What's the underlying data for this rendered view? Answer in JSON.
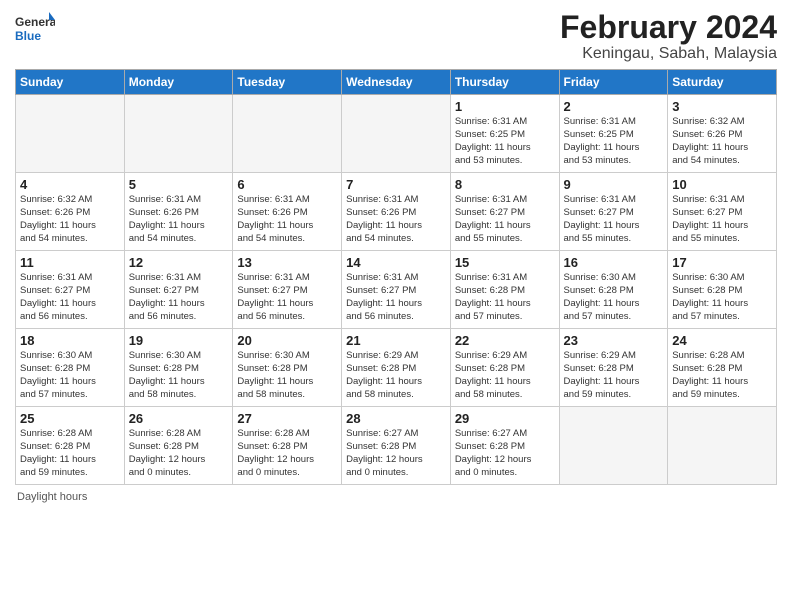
{
  "header": {
    "logo_general": "General",
    "logo_blue": "Blue",
    "month_title": "February 2024",
    "location": "Keningau, Sabah, Malaysia"
  },
  "days_of_week": [
    "Sunday",
    "Monday",
    "Tuesday",
    "Wednesday",
    "Thursday",
    "Friday",
    "Saturday"
  ],
  "weeks": [
    [
      {
        "day": "",
        "info": ""
      },
      {
        "day": "",
        "info": ""
      },
      {
        "day": "",
        "info": ""
      },
      {
        "day": "",
        "info": ""
      },
      {
        "day": "1",
        "info": "Sunrise: 6:31 AM\nSunset: 6:25 PM\nDaylight: 11 hours\nand 53 minutes."
      },
      {
        "day": "2",
        "info": "Sunrise: 6:31 AM\nSunset: 6:25 PM\nDaylight: 11 hours\nand 53 minutes."
      },
      {
        "day": "3",
        "info": "Sunrise: 6:32 AM\nSunset: 6:26 PM\nDaylight: 11 hours\nand 54 minutes."
      }
    ],
    [
      {
        "day": "4",
        "info": "Sunrise: 6:32 AM\nSunset: 6:26 PM\nDaylight: 11 hours\nand 54 minutes."
      },
      {
        "day": "5",
        "info": "Sunrise: 6:31 AM\nSunset: 6:26 PM\nDaylight: 11 hours\nand 54 minutes."
      },
      {
        "day": "6",
        "info": "Sunrise: 6:31 AM\nSunset: 6:26 PM\nDaylight: 11 hours\nand 54 minutes."
      },
      {
        "day": "7",
        "info": "Sunrise: 6:31 AM\nSunset: 6:26 PM\nDaylight: 11 hours\nand 54 minutes."
      },
      {
        "day": "8",
        "info": "Sunrise: 6:31 AM\nSunset: 6:27 PM\nDaylight: 11 hours\nand 55 minutes."
      },
      {
        "day": "9",
        "info": "Sunrise: 6:31 AM\nSunset: 6:27 PM\nDaylight: 11 hours\nand 55 minutes."
      },
      {
        "day": "10",
        "info": "Sunrise: 6:31 AM\nSunset: 6:27 PM\nDaylight: 11 hours\nand 55 minutes."
      }
    ],
    [
      {
        "day": "11",
        "info": "Sunrise: 6:31 AM\nSunset: 6:27 PM\nDaylight: 11 hours\nand 56 minutes."
      },
      {
        "day": "12",
        "info": "Sunrise: 6:31 AM\nSunset: 6:27 PM\nDaylight: 11 hours\nand 56 minutes."
      },
      {
        "day": "13",
        "info": "Sunrise: 6:31 AM\nSunset: 6:27 PM\nDaylight: 11 hours\nand 56 minutes."
      },
      {
        "day": "14",
        "info": "Sunrise: 6:31 AM\nSunset: 6:27 PM\nDaylight: 11 hours\nand 56 minutes."
      },
      {
        "day": "15",
        "info": "Sunrise: 6:31 AM\nSunset: 6:28 PM\nDaylight: 11 hours\nand 57 minutes."
      },
      {
        "day": "16",
        "info": "Sunrise: 6:30 AM\nSunset: 6:28 PM\nDaylight: 11 hours\nand 57 minutes."
      },
      {
        "day": "17",
        "info": "Sunrise: 6:30 AM\nSunset: 6:28 PM\nDaylight: 11 hours\nand 57 minutes."
      }
    ],
    [
      {
        "day": "18",
        "info": "Sunrise: 6:30 AM\nSunset: 6:28 PM\nDaylight: 11 hours\nand 57 minutes."
      },
      {
        "day": "19",
        "info": "Sunrise: 6:30 AM\nSunset: 6:28 PM\nDaylight: 11 hours\nand 58 minutes."
      },
      {
        "day": "20",
        "info": "Sunrise: 6:30 AM\nSunset: 6:28 PM\nDaylight: 11 hours\nand 58 minutes."
      },
      {
        "day": "21",
        "info": "Sunrise: 6:29 AM\nSunset: 6:28 PM\nDaylight: 11 hours\nand 58 minutes."
      },
      {
        "day": "22",
        "info": "Sunrise: 6:29 AM\nSunset: 6:28 PM\nDaylight: 11 hours\nand 58 minutes."
      },
      {
        "day": "23",
        "info": "Sunrise: 6:29 AM\nSunset: 6:28 PM\nDaylight: 11 hours\nand 59 minutes."
      },
      {
        "day": "24",
        "info": "Sunrise: 6:28 AM\nSunset: 6:28 PM\nDaylight: 11 hours\nand 59 minutes."
      }
    ],
    [
      {
        "day": "25",
        "info": "Sunrise: 6:28 AM\nSunset: 6:28 PM\nDaylight: 11 hours\nand 59 minutes."
      },
      {
        "day": "26",
        "info": "Sunrise: 6:28 AM\nSunset: 6:28 PM\nDaylight: 12 hours\nand 0 minutes."
      },
      {
        "day": "27",
        "info": "Sunrise: 6:28 AM\nSunset: 6:28 PM\nDaylight: 12 hours\nand 0 minutes."
      },
      {
        "day": "28",
        "info": "Sunrise: 6:27 AM\nSunset: 6:28 PM\nDaylight: 12 hours\nand 0 minutes."
      },
      {
        "day": "29",
        "info": "Sunrise: 6:27 AM\nSunset: 6:28 PM\nDaylight: 12 hours\nand 0 minutes."
      },
      {
        "day": "",
        "info": ""
      },
      {
        "day": "",
        "info": ""
      }
    ]
  ],
  "footer": {
    "daylight_label": "Daylight hours"
  }
}
